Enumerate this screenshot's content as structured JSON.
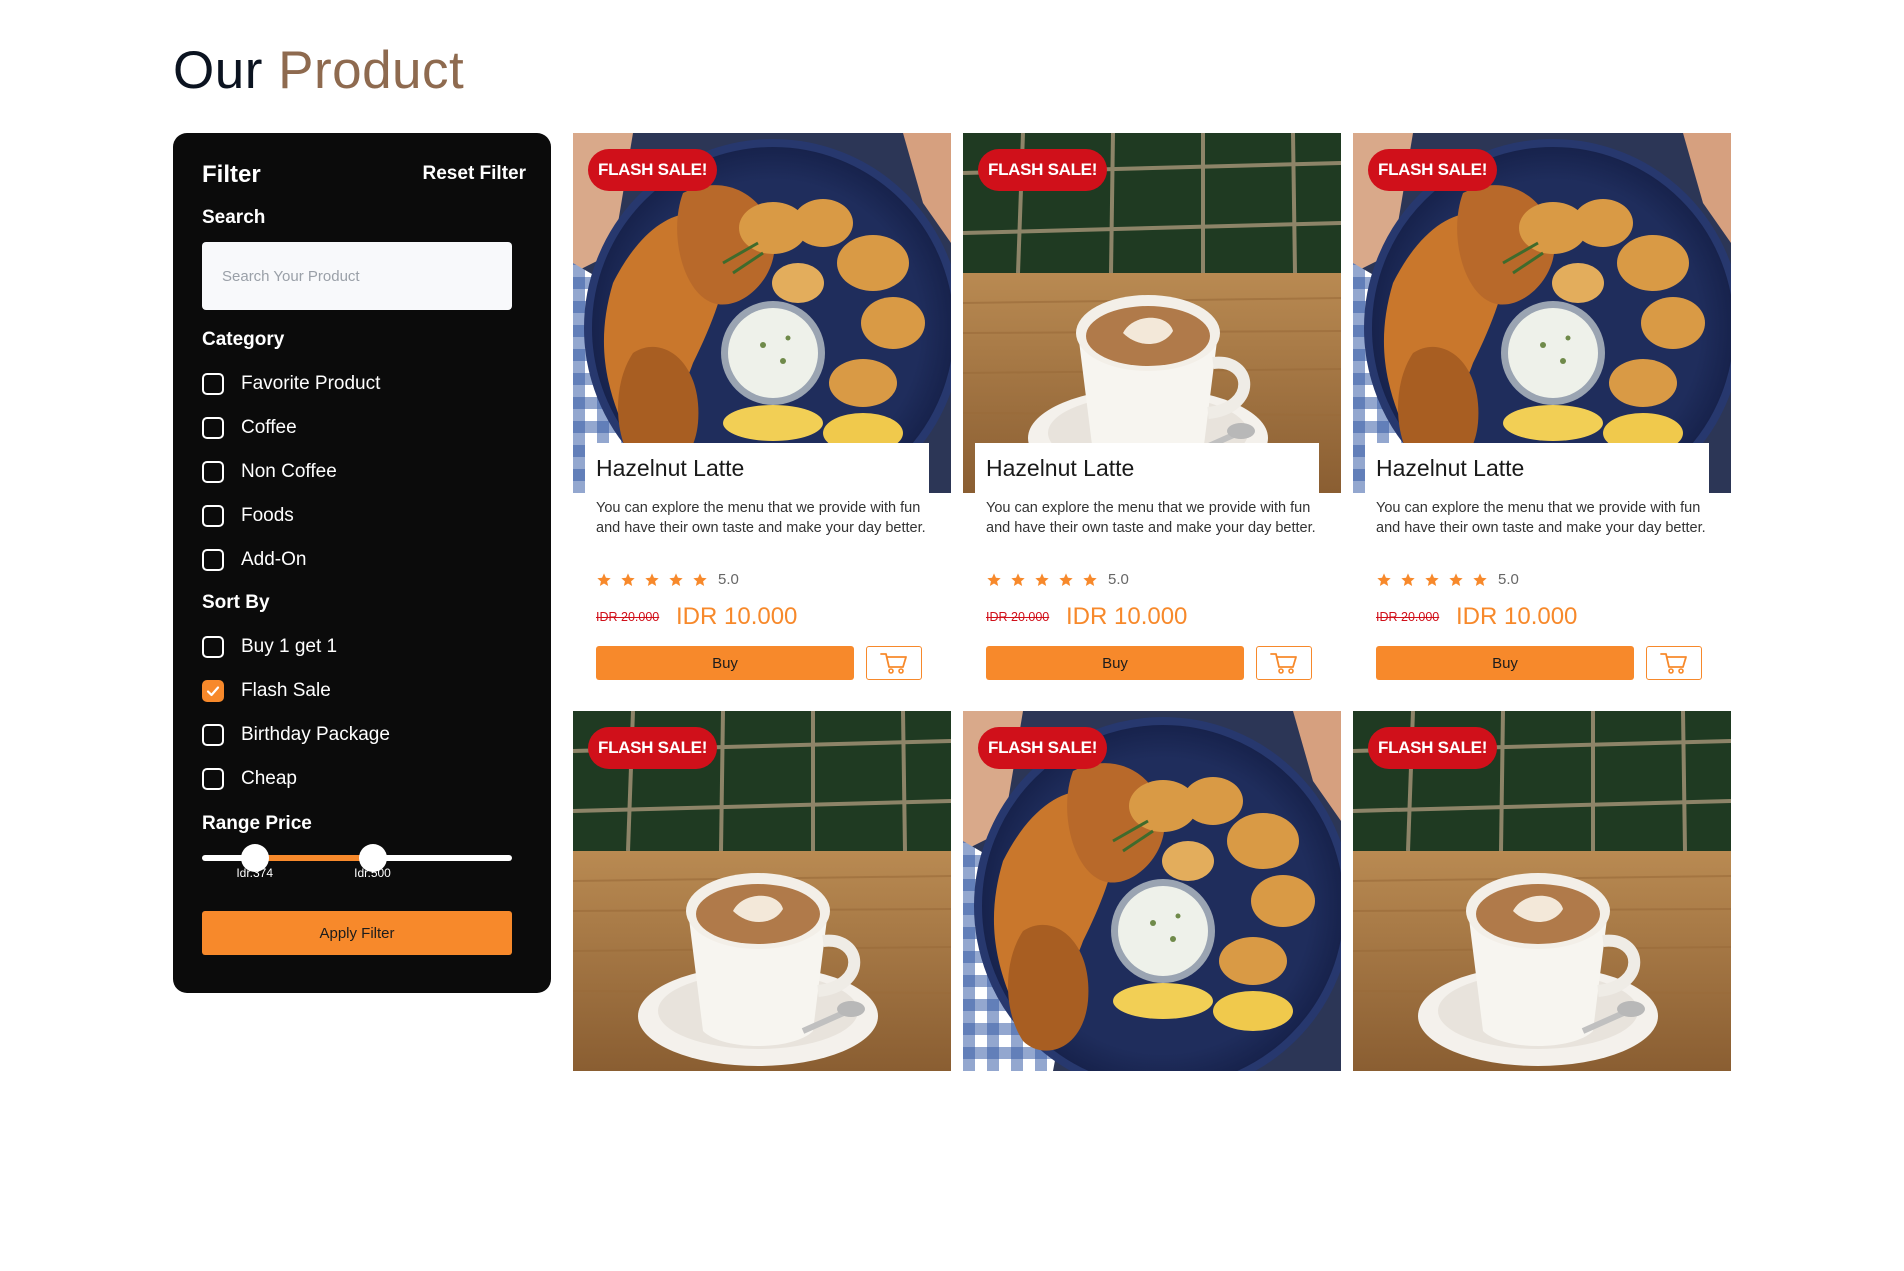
{
  "page": {
    "title_part1": "Our",
    "title_part2": "Product"
  },
  "filter": {
    "title": "Filter",
    "reset_label": "Reset Filter",
    "search_label": "Search",
    "search_placeholder": "Search Your Product",
    "search_value": "",
    "category_label": "Category",
    "categories": [
      {
        "label": "Favorite Product",
        "checked": false
      },
      {
        "label": "Coffee",
        "checked": false
      },
      {
        "label": "Non Coffee",
        "checked": false
      },
      {
        "label": "Foods",
        "checked": false
      },
      {
        "label": "Add-On",
        "checked": false
      }
    ],
    "sortby_label": "Sort By",
    "sort_options": [
      {
        "label": "Buy 1 get 1",
        "checked": false
      },
      {
        "label": "Flash Sale",
        "checked": true
      },
      {
        "label": "Birthday Package",
        "checked": false
      },
      {
        "label": "Cheap",
        "checked": false
      }
    ],
    "range_label": "Range Price",
    "range_min_label": "Idr.374",
    "range_max_label": "Idr.500",
    "range_min_fraction": 0.17,
    "range_max_fraction": 0.55,
    "apply_label": "Apply Filter"
  },
  "colors": {
    "accent": "#f7892b",
    "badge": "#d0101a",
    "title_dark": "#0b1320",
    "title_brown": "#8e6a4f",
    "sidebar_bg": "#0b0b0b"
  },
  "products": [
    {
      "image": "chicken-platter",
      "badge": "FLASH SALE!",
      "name": "Hazelnut Latte",
      "description": "You can explore the menu that we provide with fun and have their own taste and make your day better.",
      "rating": "5.0",
      "stars": 5,
      "old_price": "IDR 20.000",
      "price": "IDR 10.000",
      "buy_label": "Buy",
      "cart_icon": "cart-icon"
    },
    {
      "image": "latte-cup",
      "badge": "FLASH SALE!",
      "name": "Hazelnut Latte",
      "description": "You can explore the menu that we provide with fun and have their own taste and make your day better.",
      "rating": "5.0",
      "stars": 5,
      "old_price": "IDR 20.000",
      "price": "IDR 10.000",
      "buy_label": "Buy",
      "cart_icon": "cart-icon"
    },
    {
      "image": "chicken-platter",
      "badge": "FLASH SALE!",
      "name": "Hazelnut Latte",
      "description": "You can explore the menu that we provide with fun and have their own taste and make your day better.",
      "rating": "5.0",
      "stars": 5,
      "old_price": "IDR 20.000",
      "price": "IDR 10.000",
      "buy_label": "Buy",
      "cart_icon": "cart-icon"
    },
    {
      "image": "latte-cup",
      "badge": "FLASH SALE!"
    },
    {
      "image": "chicken-platter",
      "badge": "FLASH SALE!"
    },
    {
      "image": "latte-cup",
      "badge": "FLASH SALE!"
    }
  ]
}
